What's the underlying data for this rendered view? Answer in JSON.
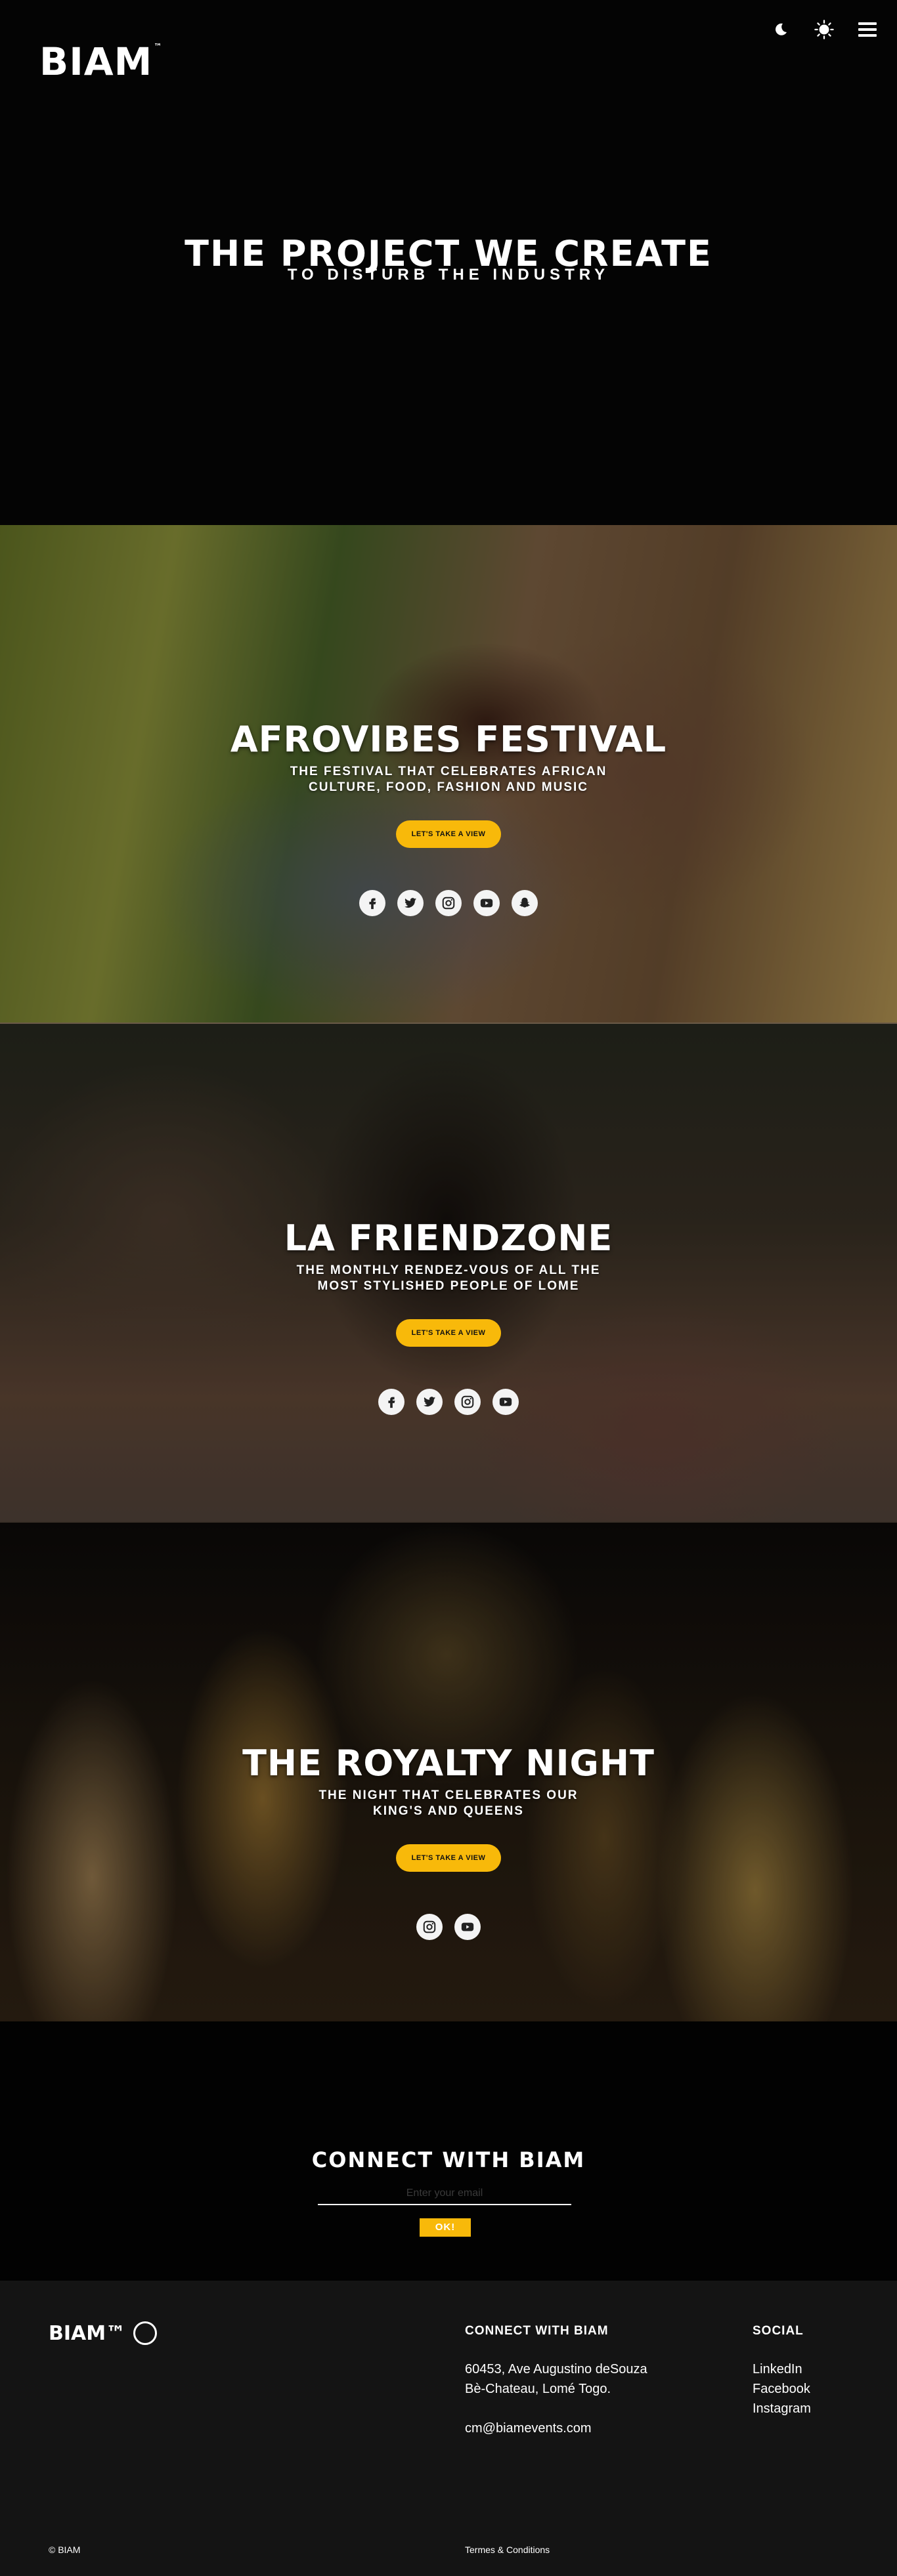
{
  "header": {
    "logo": "BIAM",
    "logo_tm": "™",
    "icons": [
      "moon-icon",
      "sun-icon",
      "hamburger-menu-icon"
    ]
  },
  "hero": {
    "title": "THE PROJECT WE CREATE",
    "subtitle": "TO DISTURB THE INDUSTRY"
  },
  "events": [
    {
      "title": "AFROVIBES FESTIVAL",
      "subtitle": "THE FESTIVAL THAT CELEBRATES AFRICAN CULTURE, FOOD, FASHION AND MUSIC",
      "cta": "LET'S TAKE A VIEW",
      "socials": [
        "facebook-icon",
        "twitter-icon",
        "instagram-icon",
        "youtube-icon",
        "snapchat-icon"
      ]
    },
    {
      "title": "LA FRIENDZONE",
      "subtitle": "THE MONTHLY RENDEZ-VOUS OF ALL THE MOST STYLISHED PEOPLE OF LOME",
      "cta": "LET'S TAKE A VIEW",
      "socials": [
        "facebook-icon",
        "twitter-icon",
        "instagram-icon",
        "youtube-icon"
      ]
    },
    {
      "title": "THE ROYALTY NIGHT",
      "subtitle": "THE NIGHT THAT CELEBRATES OUR KING'S AND QUEENS",
      "cta": "LET'S TAKE A VIEW",
      "socials": [
        "instagram-icon",
        "youtube-icon"
      ]
    }
  ],
  "connect": {
    "title": "CONNECT WITH BIAM",
    "email_placeholder": "Enter your email",
    "ok_label": "OK!"
  },
  "footer": {
    "logo": "BIAM™",
    "connect_heading": "CONNECT WITH BIAM",
    "address_line1": "60453, Ave Augustino deSouza",
    "address_line2": "Bè-Chateau, Lomé Togo.",
    "email": "cm@biamevents.com",
    "social_heading": "SOCIAL",
    "social_links": [
      "LinkedIn",
      "Facebook",
      "Instagram"
    ],
    "copyright": "© BIAM",
    "terms": "Termes & Conditions"
  },
  "colors": {
    "accent": "#f8b90a",
    "footer_bg": "#141414"
  }
}
